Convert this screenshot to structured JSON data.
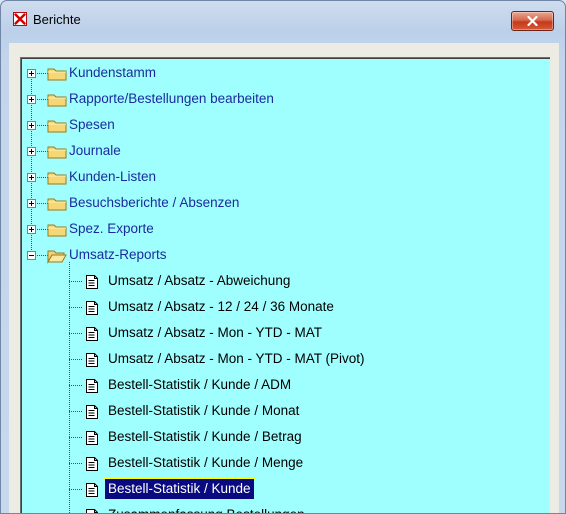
{
  "window": {
    "title": "Berichte"
  },
  "tree": {
    "folders": [
      {
        "label": "Kundenstamm",
        "expanded": false
      },
      {
        "label": "Rapporte/Bestellungen bearbeiten",
        "expanded": false
      },
      {
        "label": "Spesen",
        "expanded": false
      },
      {
        "label": "Journale",
        "expanded": false
      },
      {
        "label": "Kunden-Listen",
        "expanded": false
      },
      {
        "label": "Besuchsberichte / Absenzen",
        "expanded": false
      },
      {
        "label": "Spez. Exporte",
        "expanded": false
      },
      {
        "label": "Umsatz-Reports",
        "expanded": true
      }
    ],
    "reports": [
      {
        "label": "Umsatz / Absatz - Abweichung",
        "selected": false
      },
      {
        "label": "Umsatz / Absatz - 12 / 24 / 36 Monate",
        "selected": false
      },
      {
        "label": "Umsatz / Absatz - Mon - YTD - MAT",
        "selected": false
      },
      {
        "label": "Umsatz / Absatz - Mon - YTD - MAT (Pivot)",
        "selected": false
      },
      {
        "label": "Bestell-Statistik / Kunde / ADM",
        "selected": false
      },
      {
        "label": "Bestell-Statistik / Kunde / Monat",
        "selected": false
      },
      {
        "label": "Bestell-Statistik / Kunde / Betrag",
        "selected": false
      },
      {
        "label": "Bestell-Statistik / Kunde / Menge",
        "selected": false
      },
      {
        "label": "Bestell-Statistik / Kunde",
        "selected": true
      },
      {
        "label": "Zusammenfassung Bestellungen",
        "selected": false
      }
    ]
  },
  "colors": {
    "tree_background": "#9ffffe",
    "folder_label": "#1b2b9e",
    "selection": "#0a0a80"
  }
}
